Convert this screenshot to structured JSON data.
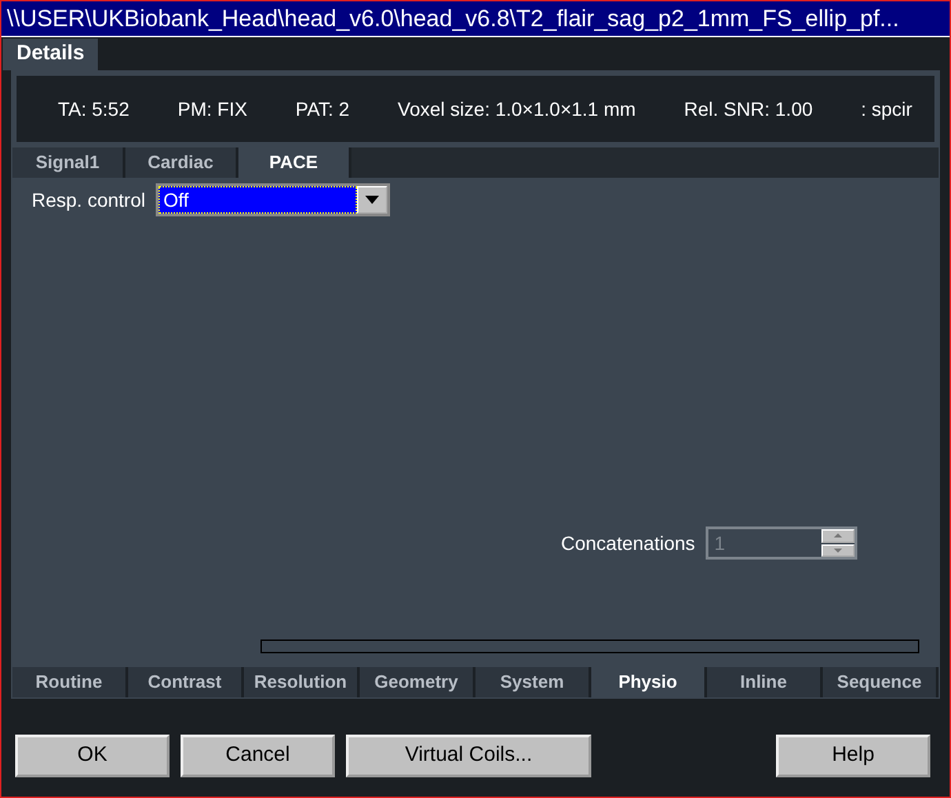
{
  "window": {
    "title": "\\\\USER\\UKBiobank_Head\\head_v6.0\\head_v6.8\\T2_flair_sag_p2_1mm_FS_ellip_pf..."
  },
  "main_tabs": [
    {
      "label": "Details",
      "selected": true
    }
  ],
  "info": [
    "TA: 5:52",
    "PM: FIX",
    "PAT: 2",
    "Voxel size: 1.0×1.0×1.1 mm",
    "Rel. SNR: 1.00",
    ": spcir"
  ],
  "sub_tabs": [
    {
      "label": "Signal1",
      "selected": false
    },
    {
      "label": "Cardiac",
      "selected": false
    },
    {
      "label": "PACE",
      "selected": true
    }
  ],
  "resp_control": {
    "label": "Resp. control",
    "value": "Off"
  },
  "concatenations": {
    "label": "Concatenations",
    "value": "1",
    "disabled": true
  },
  "progress": {
    "level": 0
  },
  "bottom_tabs": [
    {
      "label": "Routine",
      "selected": false
    },
    {
      "label": "Contrast",
      "selected": false
    },
    {
      "label": "Resolution",
      "selected": false
    },
    {
      "label": "Geometry",
      "selected": false
    },
    {
      "label": "System",
      "selected": false
    },
    {
      "label": "Physio",
      "selected": true
    },
    {
      "label": "Inline",
      "selected": false
    },
    {
      "label": "Sequence",
      "selected": false
    }
  ],
  "buttons": [
    {
      "label": "OK",
      "kind": "action"
    },
    {
      "label": "Cancel",
      "kind": "action"
    },
    {
      "label": "Virtual Coils...",
      "kind": "action"
    },
    {
      "label": "Help",
      "kind": "help"
    }
  ]
}
